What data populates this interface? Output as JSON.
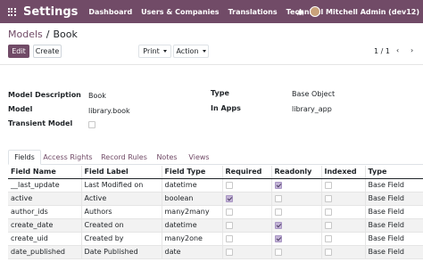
{
  "navbar": {
    "brand": "Settings",
    "menu": [
      "Dashboard",
      "Users & Companies",
      "Translations",
      "Technical"
    ],
    "user": "Mitchell Admin (dev12)",
    "apps_icon": "apps-grid-icon",
    "debug_icon": "bug-icon",
    "color": "#714B67"
  },
  "breadcrumb": {
    "parent": "Models",
    "separator": "/",
    "current": "Book"
  },
  "buttons": {
    "edit": "Edit",
    "create": "Create",
    "print": "Print",
    "action": "Action"
  },
  "pager": {
    "value": "1 / 1",
    "prev": "‹",
    "next": "›"
  },
  "form": {
    "model_description_label": "Model Description",
    "model_description": "Book",
    "model_label": "Model",
    "model": "library.book",
    "transient_label": "Transient Model",
    "transient": false,
    "type_label": "Type",
    "type": "Base Object",
    "in_apps_label": "In Apps",
    "in_apps": "library_app"
  },
  "tabs": [
    "Fields",
    "Access Rights",
    "Record Rules",
    "Notes",
    "Views"
  ],
  "table": {
    "headers": [
      "Field Name",
      "Field Label",
      "Field Type",
      "Required",
      "Readonly",
      "Indexed",
      "Type"
    ],
    "rows": [
      {
        "name": "__last_update",
        "label": "Last Modified on",
        "ftype": "datetime",
        "required": false,
        "readonly": true,
        "indexed": false,
        "type": "Base Field"
      },
      {
        "name": "active",
        "label": "Active",
        "ftype": "boolean",
        "required": true,
        "readonly": false,
        "indexed": false,
        "type": "Base Field"
      },
      {
        "name": "author_ids",
        "label": "Authors",
        "ftype": "many2many",
        "required": false,
        "readonly": false,
        "indexed": false,
        "type": "Base Field"
      },
      {
        "name": "create_date",
        "label": "Created on",
        "ftype": "datetime",
        "required": false,
        "readonly": true,
        "indexed": false,
        "type": "Base Field"
      },
      {
        "name": "create_uid",
        "label": "Created by",
        "ftype": "many2one",
        "required": false,
        "readonly": true,
        "indexed": false,
        "type": "Base Field"
      },
      {
        "name": "date_published",
        "label": "Date Published",
        "ftype": "date",
        "required": false,
        "readonly": false,
        "indexed": false,
        "type": "Base Field"
      }
    ]
  }
}
